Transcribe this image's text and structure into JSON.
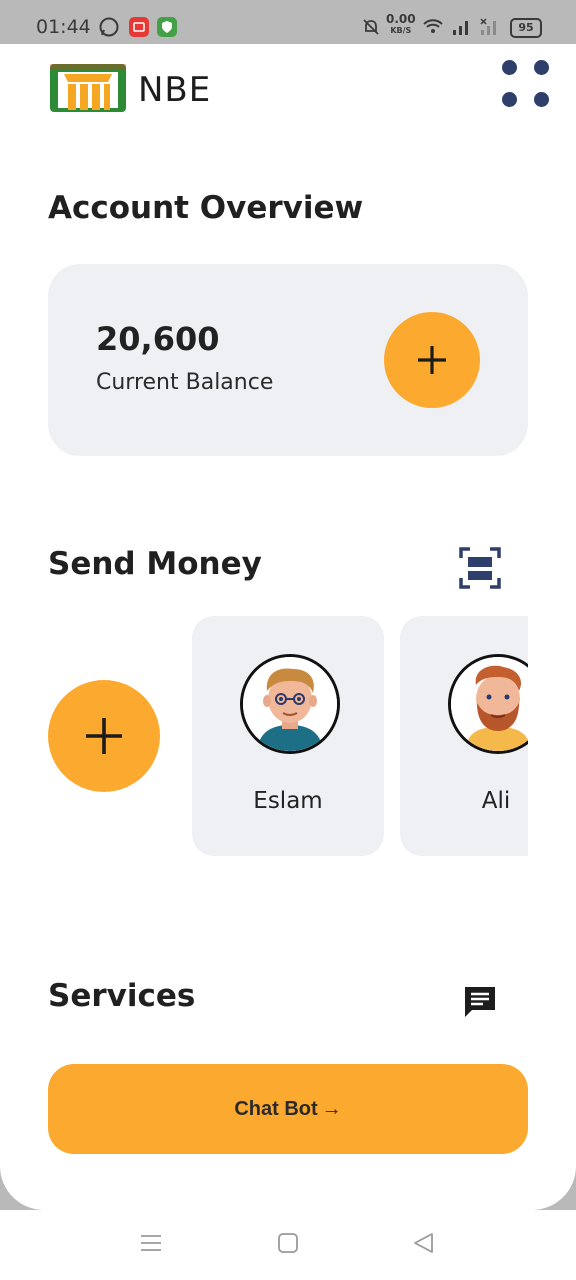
{
  "status_bar": {
    "time": "01:44",
    "network_speed": "0.00",
    "network_unit": "KB/S",
    "battery": "95"
  },
  "header": {
    "brand": "NBE",
    "logo_colors": {
      "frame": "#2e8b35",
      "pillars": "#f5a623",
      "accent": "#d9391f"
    }
  },
  "account_overview": {
    "title": "Account Overview",
    "balance_value": "20,600",
    "balance_label": "Current Balance",
    "add_symbol": "+"
  },
  "send_money": {
    "title": "Send Money",
    "add_symbol": "+",
    "contacts": [
      {
        "name": "Eslam",
        "avatar": "young-man-avatar"
      },
      {
        "name": "Ali",
        "avatar": "bearded-man-avatar"
      }
    ]
  },
  "services": {
    "title": "Services",
    "chatbot_label": "Chat Bot",
    "chatbot_arrow": "→"
  },
  "colors": {
    "accent": "#fca92f",
    "card_bg": "#eff0f4",
    "dots": "#2f3f6b"
  }
}
